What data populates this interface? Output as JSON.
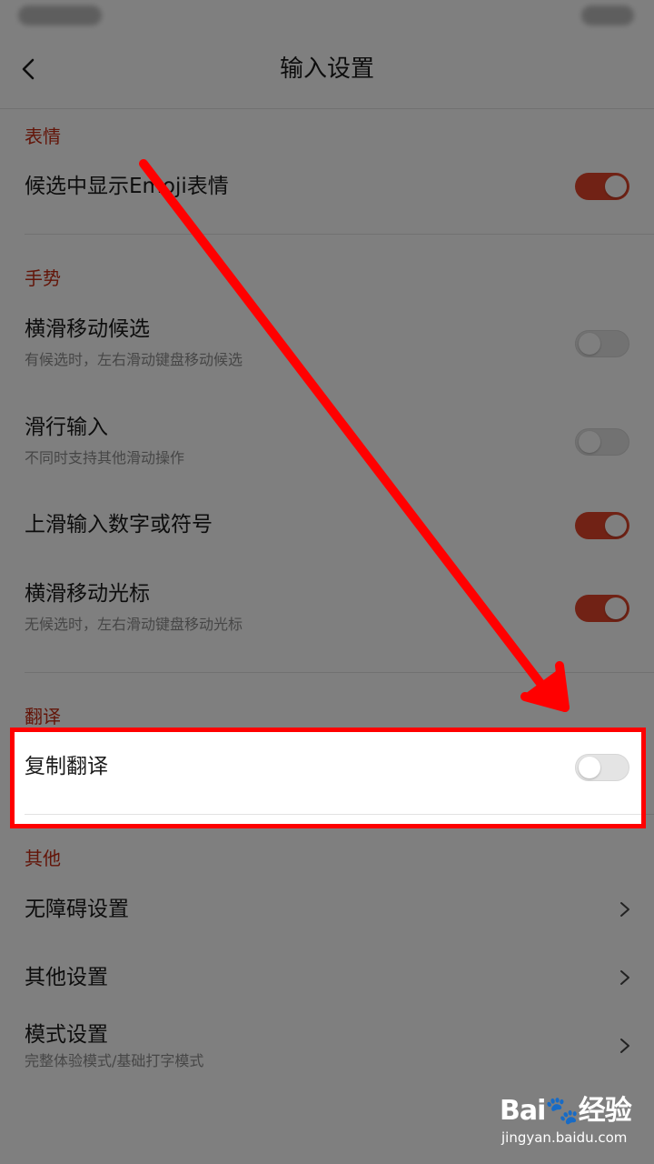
{
  "header": {
    "title": "输入设置"
  },
  "sections": {
    "emoji": {
      "title": "表情",
      "show_emoji": {
        "title": "候选中显示Emoji表情",
        "on": true
      }
    },
    "gesture": {
      "title": "手势",
      "swipe_candidates": {
        "title": "横滑移动候选",
        "subtitle": "有候选时，左右滑动键盘移动候选",
        "on": false
      },
      "glide_typing": {
        "title": "滑行输入",
        "subtitle": "不同时支持其他滑动操作",
        "on": false
      },
      "swipe_up_symbols": {
        "title": "上滑输入数字或符号",
        "on": true
      },
      "swipe_cursor": {
        "title": "横滑移动光标",
        "subtitle": "无候选时，左右滑动键盘移动光标",
        "on": true
      }
    },
    "translate": {
      "title": "翻译",
      "copy_translate": {
        "title": "复制翻译",
        "on": false
      }
    },
    "other": {
      "title": "其他",
      "accessibility": {
        "title": "无障碍设置"
      },
      "other_settings": {
        "title": "其他设置"
      },
      "mode_settings": {
        "title": "模式设置",
        "subtitle": "完整体验模式/基础打字模式"
      }
    }
  },
  "watermark": {
    "brand": "Bai🐾经验",
    "url": "jingyan.baidu.com"
  },
  "colors": {
    "accent": "#e2452a",
    "section_title": "#c62a12",
    "annotation": "#ff0000"
  }
}
